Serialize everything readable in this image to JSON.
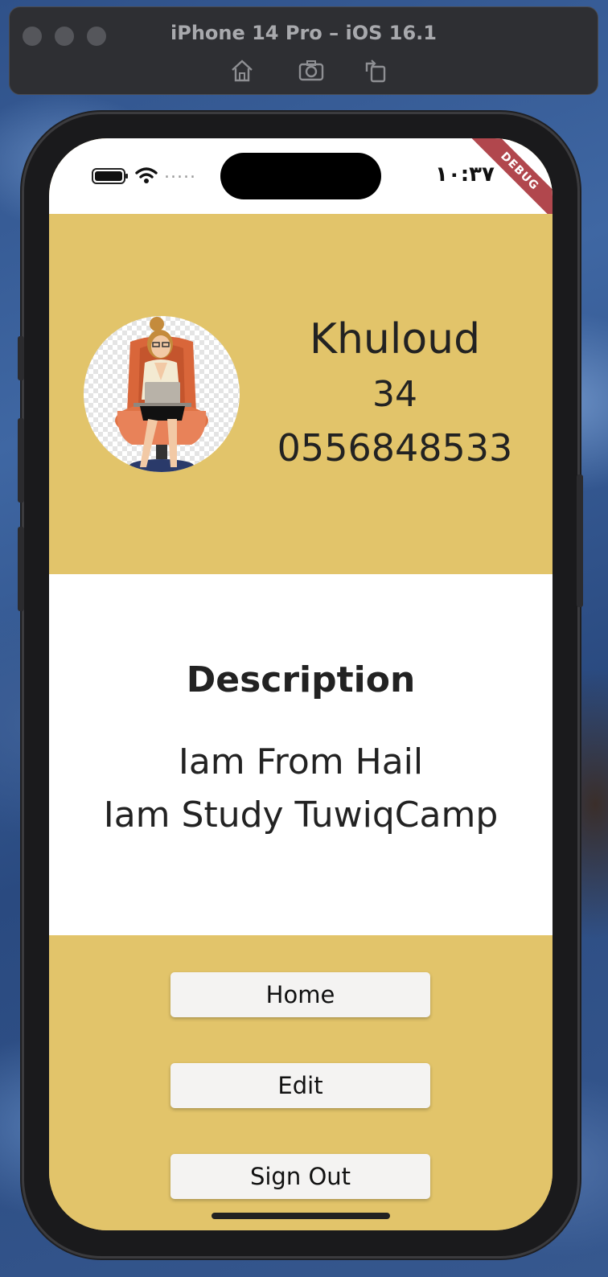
{
  "simulator": {
    "title": "iPhone 14 Pro – iOS 16.1",
    "toolbar": [
      "home-icon",
      "screenshot-icon",
      "rotate-icon"
    ]
  },
  "status_bar": {
    "time": "١٠:٣٧",
    "debug_label": "DEBUG",
    "carrier_dots": "....."
  },
  "profile": {
    "name": "Khuloud",
    "age": "34",
    "phone": "0556848533",
    "avatar": "woman-with-laptop-avatar"
  },
  "description": {
    "title": "Description",
    "line1": "Iam From Hail",
    "line2": "Iam Study TuwiqCamp"
  },
  "buttons": {
    "home": "Home",
    "edit": "Edit",
    "sign_out": "Sign Out"
  },
  "colors": {
    "accent": "#e2c46a",
    "debug_banner": "#b1474d",
    "button_bg": "#f4f3f2"
  }
}
